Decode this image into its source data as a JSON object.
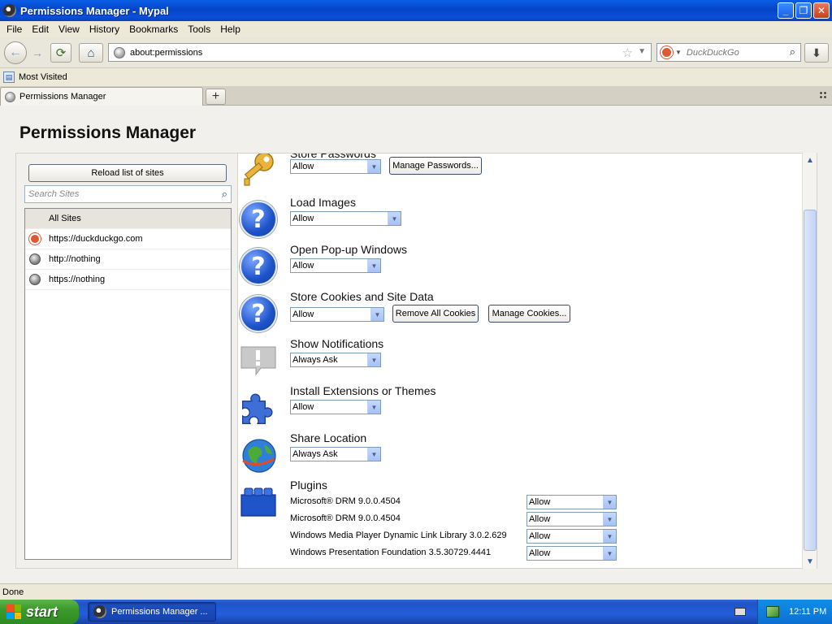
{
  "window": {
    "title": "Permissions Manager - Mypal"
  },
  "menu": [
    "File",
    "Edit",
    "View",
    "History",
    "Bookmarks",
    "Tools",
    "Help"
  ],
  "nav": {
    "url": "about:permissions",
    "search_placeholder": "DuckDuckGo"
  },
  "bookmarks": {
    "most_visited": "Most Visited"
  },
  "tab": {
    "label": "Permissions Manager"
  },
  "page": {
    "title": "Permissions Manager",
    "reload_label": "Reload list of sites",
    "search_placeholder": "Search Sites",
    "sites": [
      "All Sites",
      "https://duckduckgo.com",
      "http://nothing",
      "https://nothing"
    ]
  },
  "permissions": {
    "passwords": {
      "name": "Store Passwords",
      "value": "Allow",
      "button": "Manage Passwords..."
    },
    "images": {
      "name": "Load Images",
      "value": "Allow"
    },
    "popups": {
      "name": "Open Pop-up Windows",
      "value": "Allow"
    },
    "cookies": {
      "name": "Store Cookies and Site Data",
      "value": "Allow",
      "button1": "Remove All Cookies",
      "button2": "Manage Cookies..."
    },
    "notifications": {
      "name": "Show Notifications",
      "value": "Always Ask"
    },
    "extensions": {
      "name": "Install Extensions or Themes",
      "value": "Allow"
    },
    "location": {
      "name": "Share Location",
      "value": "Always Ask"
    },
    "plugins": {
      "name": "Plugins",
      "items": [
        {
          "name": "Microsoft® DRM 9.0.0.4504",
          "value": "Allow"
        },
        {
          "name": "Microsoft® DRM 9.0.0.4504",
          "value": "Allow"
        },
        {
          "name": "Windows Media Player  Dynamic Link Library 3.0.2.629",
          "value": "Allow"
        },
        {
          "name": "Windows Presentation Foundation 3.5.30729.4441",
          "value": "Allow"
        }
      ]
    }
  },
  "status": {
    "text": "Done"
  },
  "taskbar": {
    "start": "start",
    "item": "Permissions Manager ...",
    "clock": "12:11 PM"
  }
}
